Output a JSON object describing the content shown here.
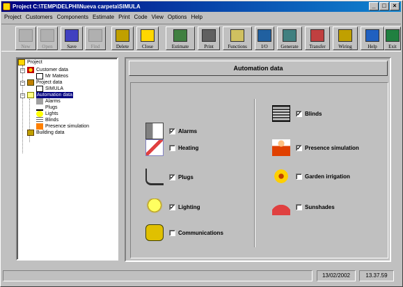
{
  "window": {
    "title": "Project C:\\TEMP\\DELPHI\\Nueva carpeta\\SIMULA",
    "min": "_",
    "max": "□",
    "close": "×"
  },
  "menu": [
    "Project",
    "Customers",
    "Components",
    "Estimate",
    "Print",
    "Code",
    "View",
    "Options",
    "Help"
  ],
  "toolbar": [
    {
      "label": "New",
      "icon": "new-icon",
      "enabled": false
    },
    {
      "label": "Open",
      "icon": "open-icon",
      "enabled": false
    },
    {
      "label": "Save",
      "icon": "save-icon",
      "enabled": true
    },
    {
      "label": "Find",
      "icon": "find-icon",
      "enabled": false
    },
    {
      "label": "Delete",
      "icon": "delete-icon",
      "enabled": true
    },
    {
      "label": "Close",
      "icon": "close-folder-icon",
      "enabled": true
    },
    {
      "label": "Estimate",
      "icon": "estimate-icon",
      "enabled": true
    },
    {
      "label": "Print",
      "icon": "print-icon",
      "enabled": true
    },
    {
      "label": "Functions",
      "icon": "functions-icon",
      "enabled": true
    },
    {
      "label": "I/O",
      "icon": "io-icon",
      "enabled": true
    },
    {
      "label": "Generate",
      "icon": "generate-icon",
      "enabled": true
    },
    {
      "label": "Transfer",
      "icon": "transfer-icon",
      "enabled": true
    },
    {
      "label": "Wiring",
      "icon": "wiring-icon",
      "enabled": true
    },
    {
      "label": "Help",
      "icon": "help-icon",
      "enabled": true
    },
    {
      "label": "Exit",
      "icon": "exit-icon",
      "enabled": true
    }
  ],
  "tree": {
    "root": "Project",
    "customer_data": "Customer data",
    "customer": "Mr Mateos",
    "project_data": "Project data",
    "project": "SIMULA",
    "automation_data": "Automation data",
    "alarms": "Alarms",
    "plugs": "Plugs",
    "lights": "Lights",
    "blinds": "Blinds",
    "presence": "Presence simulation",
    "building_data": "Building data"
  },
  "panel": {
    "title": "Automation data",
    "left": [
      {
        "label": "Alarms",
        "checked": true,
        "icon": "speaker-icon"
      },
      {
        "label": "Heating",
        "checked": false,
        "icon": "thermometer-icon"
      },
      {
        "label": "Plugs",
        "checked": true,
        "icon": "plug-icon"
      },
      {
        "label": "Lighting",
        "checked": true,
        "icon": "bulb-icon"
      },
      {
        "label": "Communications",
        "checked": false,
        "icon": "phone-icon"
      }
    ],
    "right": [
      {
        "label": "Blinds",
        "checked": true,
        "icon": "blinds-icon"
      },
      {
        "label": "Presence simulation",
        "checked": true,
        "icon": "person-icon"
      },
      {
        "label": "Garden irrigation",
        "checked": false,
        "icon": "flower-icon"
      },
      {
        "label": "Sunshades",
        "checked": false,
        "icon": "umbrella-icon"
      }
    ]
  },
  "status": {
    "date": "13/02/2002",
    "time": "13.37.59"
  }
}
